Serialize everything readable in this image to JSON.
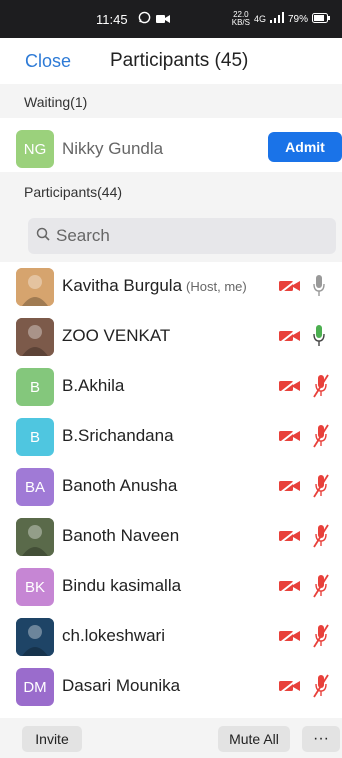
{
  "status": {
    "time": "11:45",
    "net_speed_top": "22.0",
    "net_speed_bottom": "KB/S",
    "network": "4G",
    "battery": "79%"
  },
  "header": {
    "close": "Close",
    "title": "Participants (45)"
  },
  "waiting": {
    "heading": "Waiting(1)",
    "person": {
      "initials": "NG",
      "name": "Nikky Gundla",
      "color": "#9bd17c"
    },
    "admit": "Admit"
  },
  "participants": {
    "heading": "Participants(44)",
    "search_placeholder": "Search",
    "items": [
      {
        "initials": "",
        "name": "Kavitha Burgula",
        "role": "(Host, me)",
        "photo": true,
        "color": "#d6a46e",
        "mic": "muted-gray"
      },
      {
        "initials": "",
        "name": "ZOO VENKAT",
        "role": "",
        "photo": true,
        "color": "#7c5a4a",
        "mic": "active-green"
      },
      {
        "initials": "B",
        "name": "B.Akhila",
        "role": "",
        "photo": false,
        "color": "#84c77c",
        "mic": "muted-red"
      },
      {
        "initials": "B",
        "name": "B.Srichandana",
        "role": "",
        "photo": false,
        "color": "#4fc6e0",
        "mic": "muted-red"
      },
      {
        "initials": "BA",
        "name": "Banoth Anusha",
        "role": "",
        "photo": false,
        "color": "#a07ad6",
        "mic": "muted-red"
      },
      {
        "initials": "",
        "name": "Banoth Naveen",
        "role": "",
        "photo": true,
        "color": "#5a6a4a",
        "mic": "muted-red"
      },
      {
        "initials": "BK",
        "name": "Bindu kasimalla",
        "role": "",
        "photo": false,
        "color": "#c686d4",
        "mic": "muted-red"
      },
      {
        "initials": "",
        "name": "ch.lokeshwari",
        "role": "",
        "photo": true,
        "color": "#1e4466",
        "mic": "muted-red"
      },
      {
        "initials": "DM",
        "name": "Dasari Mounika",
        "role": "",
        "photo": false,
        "color": "#9a6ccc",
        "mic": "muted-red"
      }
    ]
  },
  "footer": {
    "invite": "Invite",
    "mute_all": "Mute All",
    "more": "···"
  },
  "colors": {
    "accent": "#1a73e8",
    "muted": "#e8403a",
    "active": "#4caf50"
  }
}
